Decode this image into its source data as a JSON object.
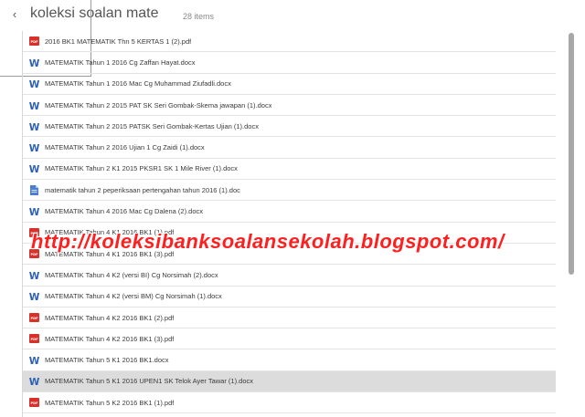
{
  "header": {
    "back_icon": "chevron-left-icon",
    "back_glyph": "‹",
    "title": "koleksi soalan mate",
    "count": "28 items"
  },
  "watermark": {
    "text": "http://koleksibanksoalansekolah.blogspot.com/",
    "color": "#ff1f1f"
  },
  "colors": {
    "pdf": "#d9312a",
    "word": "#2b5fb4",
    "doc_generic": "#4a7fd4",
    "selected_row": "#dcdcdc"
  },
  "files": [
    {
      "type": "pdf",
      "icon": "pdf-file-icon",
      "name": "2016 BK1 MATEMATIK Thn 5 KERTAS 1 (2).pdf"
    },
    {
      "type": "word",
      "icon": "word-file-icon",
      "name": "MATEMATIK Tahun 1 2016 Cg Zaffan Hayat.docx"
    },
    {
      "type": "word",
      "icon": "word-file-icon",
      "name": "MATEMATIK Tahun 1 2016 Mac Cg Muhammad Ziufadli.docx"
    },
    {
      "type": "word",
      "icon": "word-file-icon",
      "name": "MATEMATIK Tahun 2 2015 PAT SK Seri Gombak-Skema jawapan (1).docx"
    },
    {
      "type": "word",
      "icon": "word-file-icon",
      "name": "MATEMATIK Tahun 2 2015 PATSK Seri Gombak-Kertas Ujian (1).docx"
    },
    {
      "type": "word",
      "icon": "word-file-icon",
      "name": "MATEMATIK Tahun 2 2016 Ujian 1 Cg Zaidi (1).docx"
    },
    {
      "type": "word",
      "icon": "word-file-icon",
      "name": "MATEMATIK Tahun 2 K1 2015 PKSR1 SK 1 Mile River (1).docx"
    },
    {
      "type": "doc",
      "icon": "document-file-icon",
      "name": "matematik tahun 2 peperiksaan pertengahan tahun 2016 (1).doc"
    },
    {
      "type": "word",
      "icon": "word-file-icon",
      "name": "MATEMATIK Tahun 4 2016 Mac Cg Dalena (2).docx"
    },
    {
      "type": "pdf",
      "icon": "pdf-file-icon",
      "name": "MATEMATIK Tahun 4 K1 2016 BK1 (1).pdf"
    },
    {
      "type": "pdf",
      "icon": "pdf-file-icon",
      "name": "MATEMATIK Tahun 4 K1 2016 BK1 (3).pdf"
    },
    {
      "type": "word",
      "icon": "word-file-icon",
      "name": "MATEMATIK Tahun 4 K2 (versi BI) Cg Norsimah (2).docx"
    },
    {
      "type": "word",
      "icon": "word-file-icon",
      "name": "MATEMATIK Tahun 4 K2 (versi BM) Cg Norsimah (1).docx"
    },
    {
      "type": "pdf",
      "icon": "pdf-file-icon",
      "name": "MATEMATIK Tahun 4 K2 2016 BK1 (2).pdf"
    },
    {
      "type": "pdf",
      "icon": "pdf-file-icon",
      "name": "MATEMATIK Tahun 4 K2 2016 BK1 (3).pdf"
    },
    {
      "type": "word",
      "icon": "word-file-icon",
      "name": "MATEMATIK Tahun 5 K1 2016 BK1.docx"
    },
    {
      "type": "word",
      "icon": "word-file-icon",
      "name": "MATEMATIK Tahun 5 K1 2016 UPEN1 SK Telok Ayer Tawar (1).docx",
      "selected": true
    },
    {
      "type": "pdf",
      "icon": "pdf-file-icon",
      "name": "MATEMATIK Tahun 5 K2 2016 BK1 (1).pdf"
    }
  ]
}
